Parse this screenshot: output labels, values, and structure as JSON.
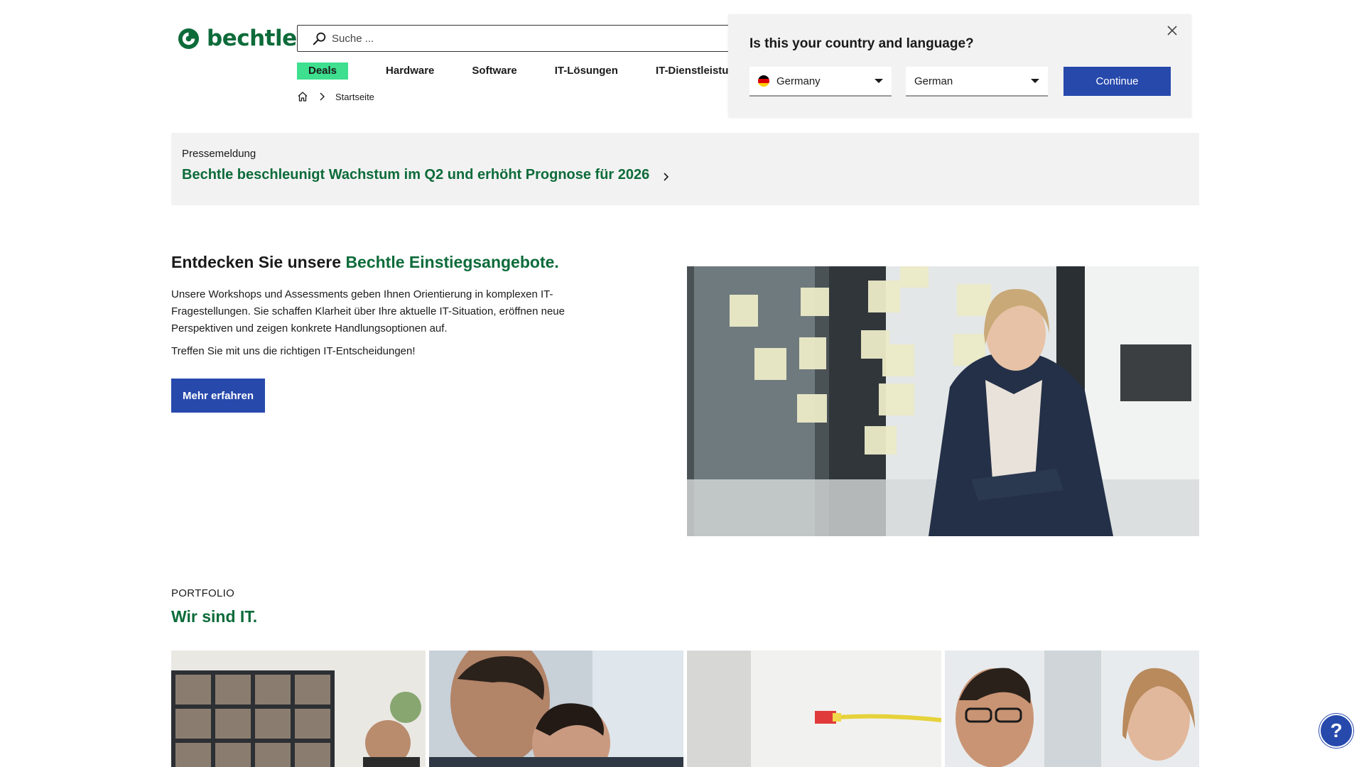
{
  "header": {
    "logo_text": "bechtle",
    "search_placeholder": "Suche ...",
    "nav": {
      "deals": "Deals",
      "hardware": "Hardware",
      "software": "Software",
      "it_loesungen": "IT-Lösungen",
      "it_dienstleistungen": "IT-Dienstleistu"
    },
    "breadcrumb": {
      "current": "Startseite"
    }
  },
  "popup": {
    "title": "Is this your country and language?",
    "country": "Germany",
    "language": "German",
    "continue_label": "Continue",
    "flag_colors": [
      "#000000",
      "#dd0000",
      "#ffce00"
    ]
  },
  "press": {
    "label": "Pressemeldung",
    "headline": "Bechtle beschleunigt Wachstum im Q2 und erhöht Prognose für 2026"
  },
  "hero": {
    "title_prefix": "Entdecken Sie unsere",
    "title_accent": "Bechtle Einstiegsangebote.",
    "body": "Unsere Workshops und Assessments geben Ihnen Orientierung in komplexen IT-Fragestellungen. Sie schaffen Klarheit über Ihre aktuelle IT-Situation, eröffnen neue Perspektiven und zeigen konkrete Handlungsoptionen auf.",
    "body2": "Treffen Sie mit uns die richtigen IT-Entscheidungen!",
    "button_label": "Mehr erfahren"
  },
  "portfolio": {
    "label": "PORTFOLIO",
    "title": "Wir sind IT."
  },
  "help": {
    "label": "?"
  },
  "colors": {
    "brand_green": "#0d6b3a",
    "deals_green": "#3ee08f",
    "primary_blue": "#2749ac",
    "panel_gray": "#f2f2f2"
  },
  "icons": [
    "logo-mark-icon",
    "search-icon",
    "home-icon",
    "chevron-right-icon",
    "close-icon",
    "caret-down-icon"
  ]
}
